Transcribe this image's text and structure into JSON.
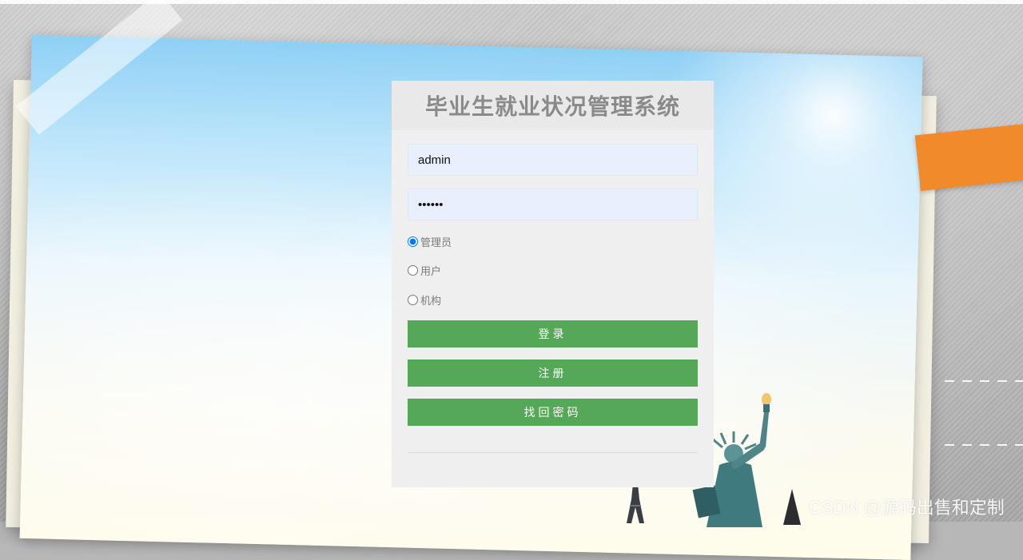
{
  "login": {
    "title": "毕业生就业状况管理系统",
    "username": {
      "value": "admin"
    },
    "password": {
      "value": "123456"
    },
    "roles": [
      {
        "label": "管理员",
        "checked": true
      },
      {
        "label": "用户",
        "checked": false
      },
      {
        "label": "机构",
        "checked": false
      }
    ],
    "buttons": {
      "login": "登录",
      "register": "注册",
      "forgot": "找回密码"
    }
  },
  "watermark": "CSDN @源码出售和定制",
  "colors": {
    "button": "#55a858",
    "panel": "#efefef",
    "input": "#e8f0fe",
    "accent_tab": "#f08a2a"
  }
}
